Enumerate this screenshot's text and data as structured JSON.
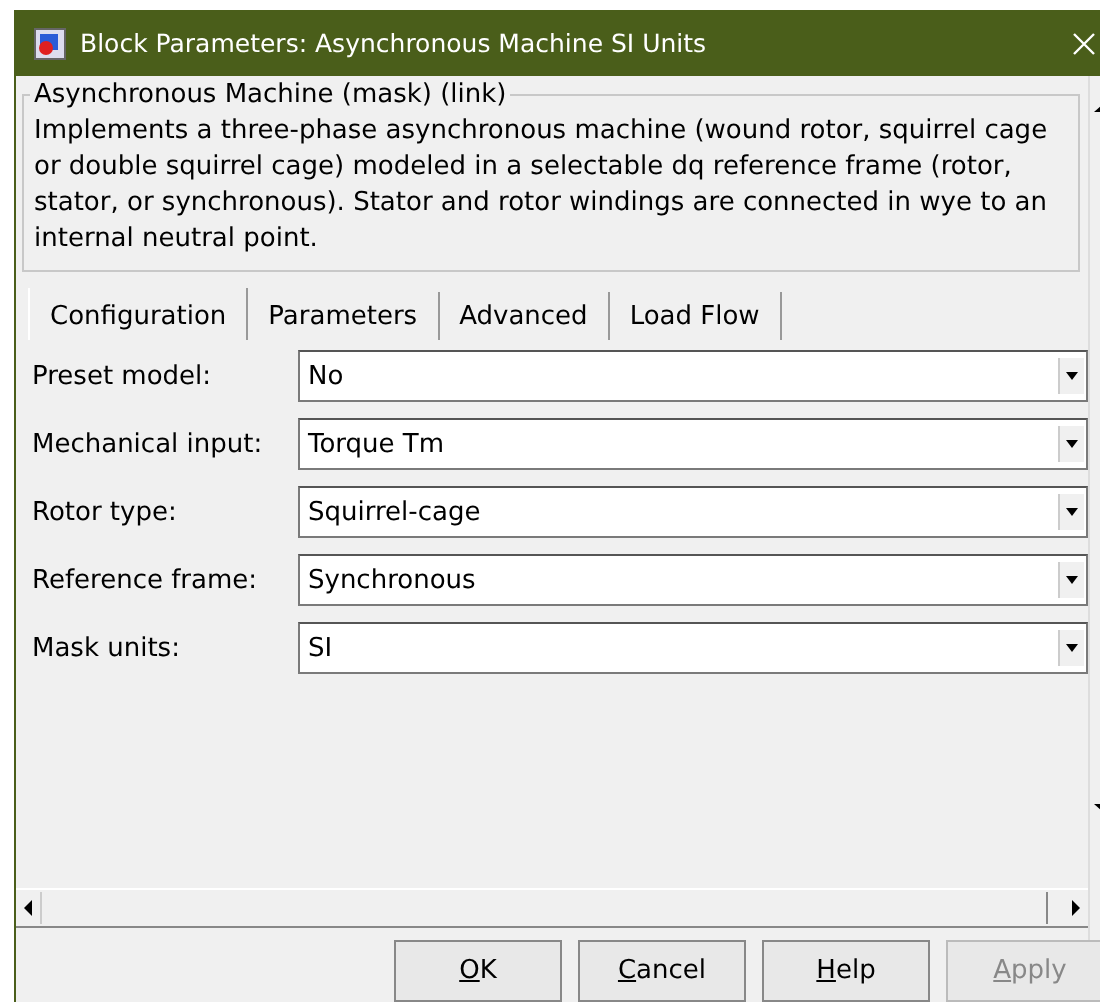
{
  "window": {
    "title": "Block Parameters: Asynchronous Machine SI Units"
  },
  "group": {
    "title": "Asynchronous Machine (mask) (link)",
    "description": "Implements a three-phase asynchronous machine (wound rotor, squirrel cage or double squirrel cage) modeled in a selectable dq reference frame (rotor, stator, or synchronous). Stator and rotor windings are connected in wye to an internal neutral point."
  },
  "tabs": [
    {
      "label": "Configuration",
      "selected": true
    },
    {
      "label": "Parameters",
      "selected": false
    },
    {
      "label": "Advanced",
      "selected": false
    },
    {
      "label": "Load Flow",
      "selected": false
    }
  ],
  "fields": [
    {
      "label": "Preset model:",
      "value": "No"
    },
    {
      "label": "Mechanical input:",
      "value": "Torque Tm"
    },
    {
      "label": "Rotor type:",
      "value": "Squirrel-cage"
    },
    {
      "label": "Reference frame:",
      "value": "Synchronous"
    },
    {
      "label": "Mask units:",
      "value": "SI"
    }
  ],
  "buttons": [
    {
      "label": "OK",
      "disabled": false
    },
    {
      "label": "Cancel",
      "disabled": false
    },
    {
      "label": "Help",
      "disabled": false
    },
    {
      "label": "Apply",
      "disabled": true
    }
  ]
}
